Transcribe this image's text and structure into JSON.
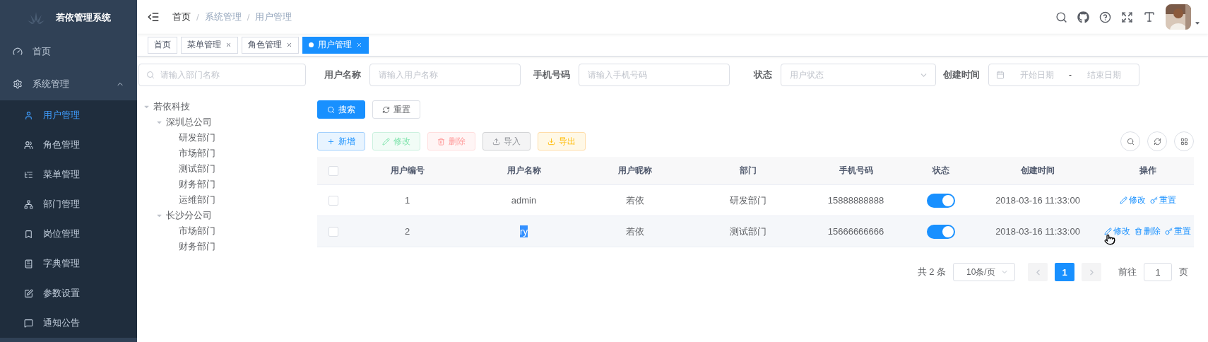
{
  "sidebar": {
    "logo_title": "若依管理系统",
    "items": [
      {
        "label": "首页",
        "selected": false
      },
      {
        "label": "系统管理",
        "selected": false,
        "expanded": true,
        "children": [
          {
            "label": "用户管理",
            "selected": true
          },
          {
            "label": "角色管理",
            "selected": false
          },
          {
            "label": "菜单管理",
            "selected": false
          },
          {
            "label": "部门管理",
            "selected": false
          },
          {
            "label": "岗位管理",
            "selected": false
          },
          {
            "label": "字典管理",
            "selected": false
          },
          {
            "label": "参数设置",
            "selected": false
          },
          {
            "label": "通知公告",
            "selected": false
          }
        ]
      }
    ]
  },
  "header": {
    "breadcrumb": [
      "首页",
      "系统管理",
      "用户管理"
    ],
    "breadcrumb_separator": "/"
  },
  "tags": [
    {
      "label": "首页",
      "selected": false,
      "closable": false
    },
    {
      "label": "菜单管理",
      "selected": false,
      "closable": true
    },
    {
      "label": "角色管理",
      "selected": false,
      "closable": true
    },
    {
      "label": "用户管理",
      "selected": true,
      "closable": true
    }
  ],
  "dept_tree": {
    "search": {
      "placeholder": "请输入部门名称"
    },
    "nodes": [
      {
        "label": "若依科技",
        "expanded": true,
        "children": [
          {
            "label": "深圳总公司",
            "expanded": true,
            "children": [
              {
                "label": "研发部门"
              },
              {
                "label": "市场部门"
              },
              {
                "label": "测试部门"
              },
              {
                "label": "财务部门"
              },
              {
                "label": "运维部门"
              }
            ]
          },
          {
            "label": "长沙分公司",
            "expanded": true,
            "children": [
              {
                "label": "市场部门"
              },
              {
                "label": "财务部门"
              }
            ]
          }
        ]
      }
    ]
  },
  "filters": [
    {
      "kind": "text",
      "label": "用户名称",
      "placeholder": "请输入用户名称"
    },
    {
      "kind": "text",
      "label": "手机号码",
      "placeholder": "请输入手机号码"
    },
    {
      "kind": "select",
      "label": "状态",
      "placeholder": "用户状态"
    },
    {
      "kind": "daterange",
      "label": "创建时间",
      "start_placeholder": "开始日期",
      "separator": "-",
      "end_placeholder": "结束日期"
    }
  ],
  "search_buttons": [
    {
      "kind": "search",
      "label": "搜索"
    },
    {
      "kind": "reset",
      "label": "重置"
    }
  ],
  "toolbar": [
    {
      "kind": "primary",
      "label": "新增",
      "disabled": false
    },
    {
      "kind": "success",
      "label": "修改",
      "disabled": true
    },
    {
      "kind": "danger",
      "label": "删除",
      "disabled": true
    },
    {
      "kind": "info",
      "label": "导入",
      "disabled": false
    },
    {
      "kind": "warning",
      "label": "导出",
      "disabled": false
    }
  ],
  "table": {
    "header_checked": false,
    "columns": [
      "用户编号",
      "用户名称",
      "用户昵称",
      "部门",
      "手机号码",
      "状态",
      "创建时间",
      "操作"
    ],
    "rows": [
      {
        "checked": false,
        "hovered": false,
        "id": "1",
        "username": "admin",
        "username_highlighted": false,
        "nickname": "若依",
        "dept": "研发部门",
        "phone": "15888888888",
        "status_on": true,
        "created": "2018-03-16 11:33:00",
        "actions": [
          {
            "kind": "edit",
            "label": "修改"
          },
          {
            "kind": "reset",
            "label": "重置"
          }
        ]
      },
      {
        "checked": false,
        "hovered": true,
        "id": "2",
        "username": "ry",
        "username_highlighted": true,
        "nickname": "若依",
        "dept": "测试部门",
        "phone": "15666666666",
        "status_on": true,
        "created": "2018-03-16 11:33:00",
        "actions": [
          {
            "kind": "edit",
            "label": "修改"
          },
          {
            "kind": "delete",
            "label": "删除"
          },
          {
            "kind": "reset",
            "label": "重置"
          }
        ]
      }
    ]
  },
  "pagination": {
    "total": "共 2 条",
    "page_size": "10条/页",
    "pages": [
      {
        "label": "1",
        "selected": true
      }
    ],
    "prev_disabled": true,
    "next_disabled": true,
    "goto_label": "前往",
    "goto_value": "1",
    "goto_suffix": "页"
  }
}
